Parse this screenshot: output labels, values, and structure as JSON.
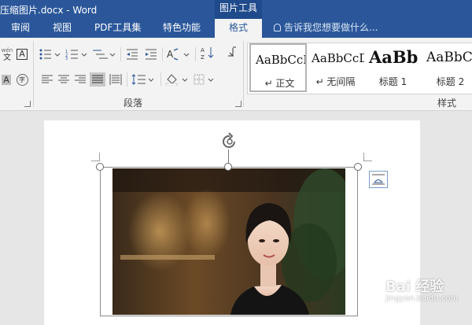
{
  "window": {
    "title": "压缩图片.docx - Word",
    "context_group": "图片工具"
  },
  "tabs": [
    {
      "label": "审阅",
      "active": false
    },
    {
      "label": "视图",
      "active": false
    },
    {
      "label": "PDF工具集",
      "active": false
    },
    {
      "label": "特色功能",
      "active": false
    },
    {
      "label": "格式",
      "active": true
    }
  ],
  "tell_me": {
    "placeholder": "告诉我您想要做什么..."
  },
  "ribbon": {
    "font_fragments": {
      "phonetic_guide": "wén",
      "phonetic_char": "文",
      "border_char": "A",
      "shade_char": "A",
      "enclose_char": "字"
    },
    "paragraph": {
      "group_label": "段落"
    },
    "styles": {
      "group_label": "样式",
      "items": [
        {
          "sample": "AaBbCcDd",
          "name": "↵ 正文",
          "selected": true
        },
        {
          "sample": "AaBbCcDd",
          "name": "↵ 无间隔",
          "selected": false
        },
        {
          "sample": "AaBb",
          "name": "标题 1",
          "selected": false
        },
        {
          "sample": "AaBbC",
          "name": "标题 2",
          "selected": false
        }
      ]
    }
  },
  "watermark": {
    "text": "Bai 经验",
    "sub": "jingyan.baidu.com"
  },
  "colors": {
    "brand": "#2b579a",
    "ribbon": "#f3f3f3",
    "canvas": "#e6e6e6"
  }
}
